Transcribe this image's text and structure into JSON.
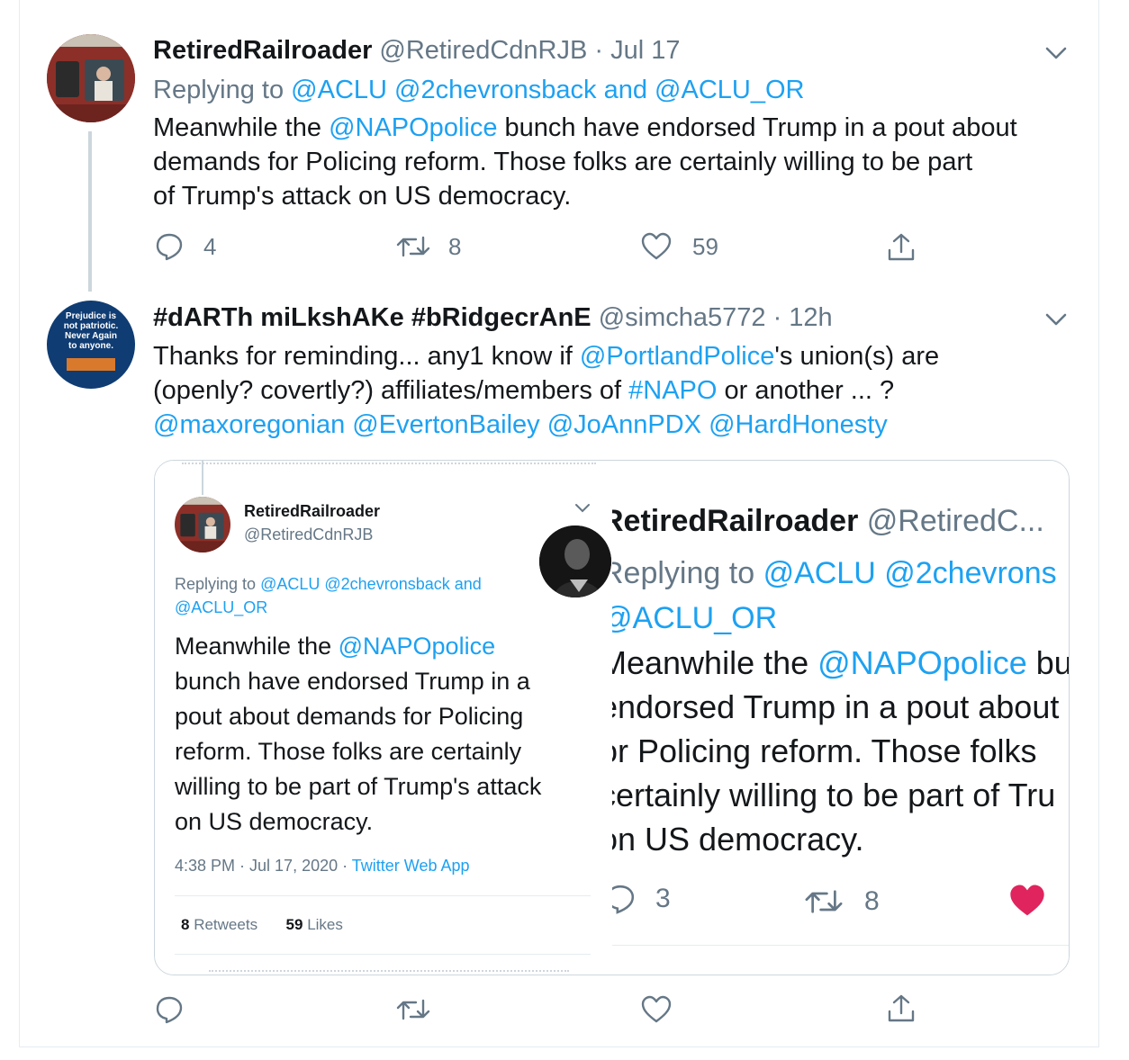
{
  "tweet1": {
    "display_name": "RetiredRailroader",
    "handle": "@RetiredCdnRJB",
    "time": "Jul 17",
    "replying_prefix": "Replying to",
    "reply_1": "@ACLU",
    "reply_2": "@2chevronsback",
    "reply_and": "and",
    "reply_3": "@ACLU_OR",
    "text_a": "Meanwhile the ",
    "mention": "@NAPOpolice",
    "text_b": " bunch have endorsed Trump in a pout about",
    "line2": "demands for Policing reform.  Those folks are certainly willing to be part",
    "line3": "of Trump's attack on US democracy.",
    "replies": "4",
    "retweets": "8",
    "likes": "59"
  },
  "tweet2": {
    "display_name": "#dARTh miLkshAKe #bRidgecrAnE",
    "handle": "@simcha5772",
    "time": "12h",
    "avatar_text": [
      "Prejudice is",
      "not patriotic.",
      "Never Again",
      "to anyone."
    ],
    "line1_a": "Thanks for reminding... any1 know if ",
    "line1_mention": "@PortlandPolice",
    "line1_b": "'s union(s) are",
    "line2_a": "(openly? covertly?) affiliates/members of ",
    "line2_tag": "#NAPO",
    "line2_b": " or another ... ?",
    "mentions": [
      "@maxoregonian",
      "@EvertonBailey",
      "@JoAnnPDX",
      "@HardHonesty"
    ]
  },
  "embed_left": {
    "display_name": "RetiredRailroader",
    "handle": "@RetiredCdnRJB",
    "replying_prefix": "Replying to",
    "reply_1": "@ACLU",
    "reply_2": "@2chevronsback",
    "reply_and": "and",
    "reply_3": "@ACLU_OR",
    "l1a": "Meanwhile the ",
    "l1m": "@NAPOpolice",
    "l2": "bunch have endorsed Trump in a",
    "l3": "pout about demands for Policing",
    "l4": "reform.  Those folks are certainly",
    "l5": "willing to be part of Trump's attack",
    "l6": "on US democracy.",
    "timestamp": "4:38 PM · Jul 17, 2020 · ",
    "source": "Twitter Web App",
    "retweets_count": "8",
    "retweets_label": "Retweets",
    "likes_count": "59",
    "likes_label": "Likes"
  },
  "embed_right": {
    "display_name": "RetiredRailroader",
    "handle": "@RetiredC...",
    "replying_prefix": "Replying to",
    "reply_1": "@ACLU",
    "reply_2": "@2chevrons",
    "reply_3": "@ACLU_OR",
    "l1a": "Meanwhile the ",
    "l1m": "@NAPOpolice",
    "l1b": " bu",
    "l2": "endorsed Trump in a pout about",
    "l3": "or Policing reform.  Those folks",
    "l4": "certainly willing to be part of Tru",
    "l5": "on US democracy.",
    "replies": "3",
    "retweets": "8"
  },
  "colors": {
    "link": "#1da1f2",
    "muted": "#657786",
    "like_red": "#e0245e"
  }
}
